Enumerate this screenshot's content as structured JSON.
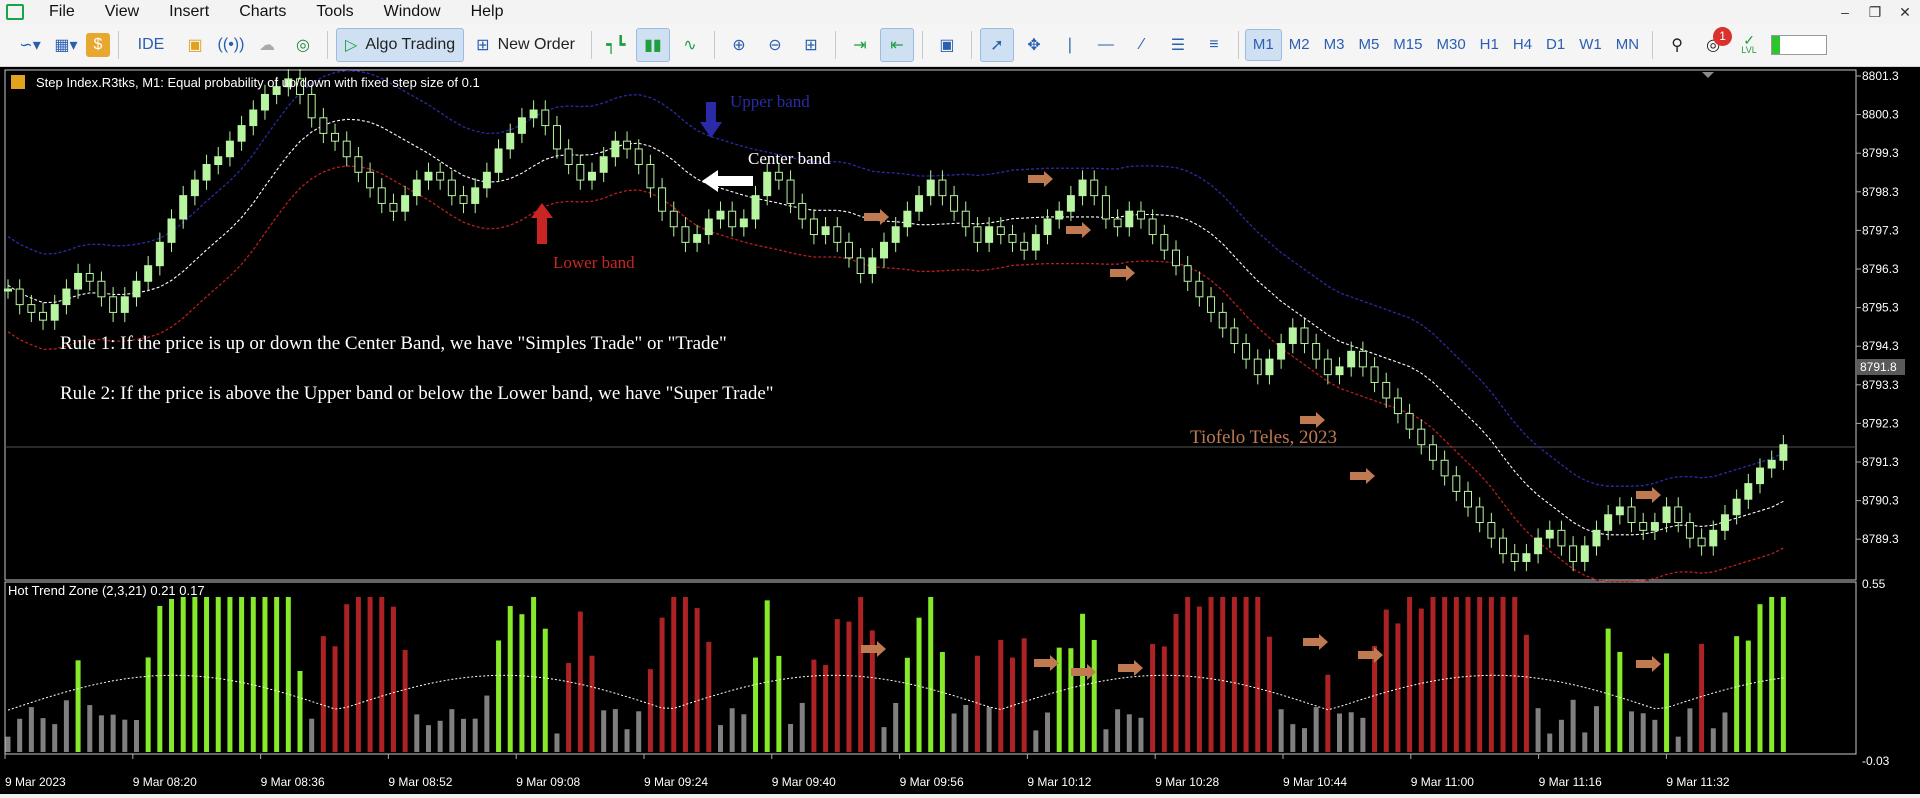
{
  "menu": [
    "File",
    "View",
    "Insert",
    "Charts",
    "Tools",
    "Window",
    "Help"
  ],
  "toolbar": {
    "ide_label": "IDE",
    "algo_trading_label": "Algo Trading",
    "new_order_label": "New Order",
    "timeframes": [
      "M1",
      "M2",
      "M3",
      "M5",
      "M15",
      "M30",
      "H1",
      "H4",
      "D1",
      "W1",
      "MN"
    ],
    "active_timeframe": "M1",
    "notification_count": "1",
    "signal_label": "LVL"
  },
  "chart": {
    "symbol_info": "Step Index.R3tks, M1:  Equal probability of up/down with fixed step size of 0.1",
    "price_ticks": [
      "8801.3",
      "8800.3",
      "8799.3",
      "8798.3",
      "8797.3",
      "8796.3",
      "8795.3",
      "8794.3",
      "8793.3",
      "8792.3",
      "8791.3",
      "8790.3",
      "8789.3"
    ],
    "current_price": "8791.8",
    "time_ticks": [
      "9 Mar 2023",
      "9 Mar 08:20",
      "9 Mar 08:36",
      "9 Mar 08:52",
      "9 Mar 09:08",
      "9 Mar 09:24",
      "9 Mar 09:40",
      "9 Mar 09:56",
      "9 Mar 10:12",
      "9 Mar 10:28",
      "9 Mar 10:44",
      "9 Mar 11:00",
      "9 Mar 11:16",
      "9 Mar 11:32"
    ]
  },
  "annotations": {
    "upper_band": "Upper band",
    "center_band": "Center band",
    "lower_band": "Lower band",
    "rule1": "Rule 1: If the price is up or down the Center Band, we have \"Simples Trade\" or \"Trade\"",
    "rule2": "Rule 2: If the price is above the Upper band or below the Lower band, we have \"Super Trade\"",
    "author": "Tiofelo Teles, 2023"
  },
  "indicator": {
    "title": "Hot Trend Zone (2,3,21) 0.21 0.17",
    "max_label": "0.55",
    "min_label": "-0.03"
  },
  "colors": {
    "bull_candle": "#b8f5a0",
    "bear_candle": "#000000",
    "upper_band": "#2b2ba8",
    "center_band": "#ffffff",
    "lower_band": "#b81e1e",
    "hist_green": "#86ea2a",
    "hist_red": "#ad2323",
    "hist_gray": "#808080",
    "signal_arrow": "#c07a52"
  },
  "chart_data": {
    "type": "candlestick",
    "price_path": [
      8795.8,
      8795.4,
      8795.2,
      8795.0,
      8795.4,
      8795.8,
      8796.2,
      8796.0,
      8795.6,
      8795.2,
      8795.6,
      8796.0,
      8796.4,
      8797.0,
      8797.6,
      8798.2,
      8798.6,
      8799.0,
      8799.2,
      8799.6,
      8800.0,
      8800.4,
      8800.8,
      8801.0,
      8801.2,
      8800.8,
      8800.2,
      8799.8,
      8799.6,
      8799.2,
      8798.8,
      8798.4,
      8798.0,
      8797.8,
      8798.2,
      8798.6,
      8798.8,
      8798.6,
      8798.2,
      8798.0,
      8798.4,
      8798.8,
      8799.4,
      8799.8,
      8800.2,
      8800.4,
      8800.0,
      8799.4,
      8799.0,
      8798.6,
      8798.8,
      8799.2,
      8799.6,
      8799.4,
      8799.0,
      8798.4,
      8797.8,
      8797.4,
      8797.0,
      8797.2,
      8797.6,
      8797.8,
      8797.4,
      8797.6,
      8798.2,
      8798.8,
      8798.6,
      8798.0,
      8797.6,
      8797.2,
      8797.4,
      8797.0,
      8796.6,
      8796.2,
      8796.6,
      8797.0,
      8797.4,
      8797.8,
      8798.2,
      8798.6,
      8798.2,
      8797.8,
      8797.4,
      8797.0,
      8797.4,
      8797.2,
      8797.0,
      8796.8,
      8797.2,
      8797.6,
      8797.8,
      8798.2,
      8798.6,
      8798.2,
      8797.6,
      8797.4,
      8797.8,
      8797.6,
      8797.2,
      8796.8,
      8796.4,
      8796.0,
      8795.6,
      8795.2,
      8794.8,
      8794.4,
      8794.0,
      8793.6,
      8794.0,
      8794.4,
      8794.8,
      8794.4,
      8794.0,
      8793.6,
      8793.8,
      8794.2,
      8793.8,
      8793.4,
      8793.0,
      8792.6,
      8792.2,
      8791.8,
      8791.4,
      8791.0,
      8790.6,
      8790.2,
      8789.8,
      8789.4,
      8789.0,
      8788.8,
      8789.0,
      8789.4,
      8789.6,
      8789.2,
      8788.8,
      8789.2,
      8789.6,
      8790.0,
      8790.2,
      8789.8,
      8789.6,
      8789.8,
      8790.2,
      8789.8,
      8789.4,
      8789.2,
      8789.6,
      8790.0,
      8790.4,
      8790.8,
      8791.2,
      8791.4,
      8791.8
    ]
  }
}
